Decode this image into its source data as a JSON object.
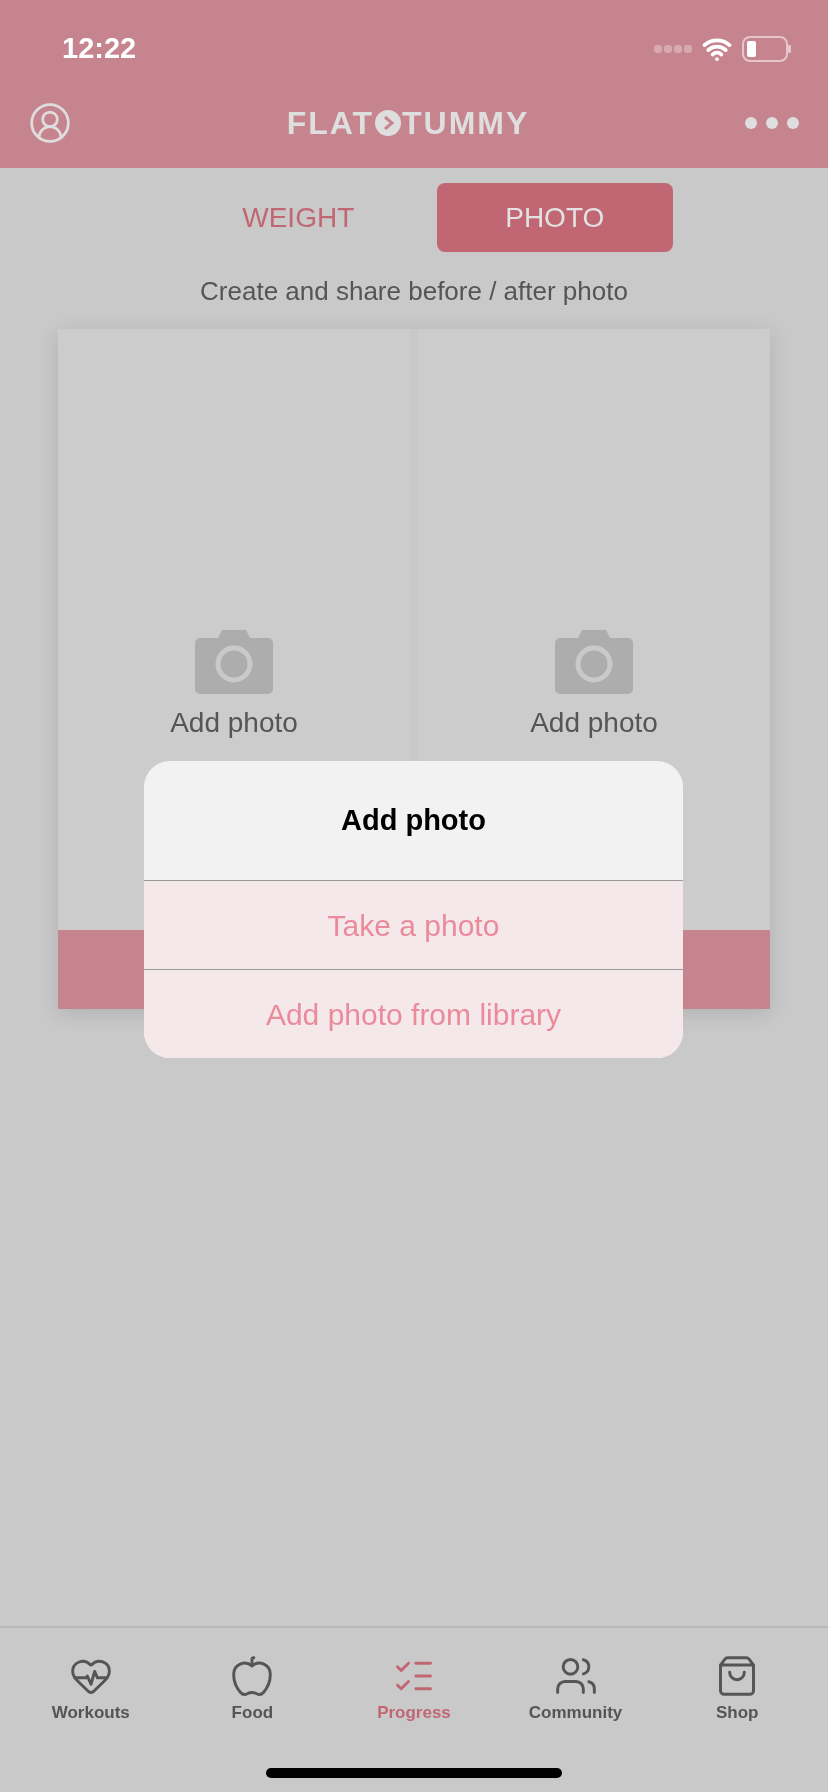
{
  "status_bar": {
    "time": "12:22"
  },
  "header": {
    "logo_left": "FLAT",
    "logo_right": "TUMMY"
  },
  "segments": [
    {
      "label": "WEIGHT",
      "selected": false
    },
    {
      "label": "PHOTO",
      "selected": true
    }
  ],
  "subtitle": "Create and share before / after photo",
  "photo_slots": [
    {
      "label": "Add photo"
    },
    {
      "label": "Add photo"
    }
  ],
  "dialog": {
    "title": "Add photo",
    "actions": [
      "Take a photo",
      "Add photo from library"
    ]
  },
  "tab_bar": [
    {
      "kind": "heart",
      "label": "Workouts",
      "selected": false
    },
    {
      "kind": "apple",
      "label": "Food",
      "selected": false
    },
    {
      "kind": "list",
      "label": "Progress",
      "selected": true
    },
    {
      "kind": "people",
      "label": "Community",
      "selected": false
    },
    {
      "kind": "bag",
      "label": "Shop",
      "selected": false
    }
  ]
}
